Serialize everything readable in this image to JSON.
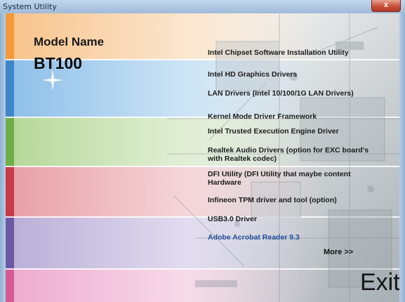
{
  "window": {
    "title": "System Utility",
    "close_label": "x"
  },
  "model": {
    "label": "Model Name",
    "value": "BT100"
  },
  "menu": {
    "items": [
      {
        "label": "Intel Chipset Software Installation Utility"
      },
      {
        "label": "Intel HD Graphics Drivers"
      },
      {
        "label": "LAN Drivers  (Intel 10/100/1G LAN Drivers)"
      },
      {
        "label": "Kernel Mode Driver Framework"
      },
      {
        "label": "Intel Trusted Execution Engine Driver"
      },
      {
        "label": "Realtek Audio Drivers  (option for EXC board's with Realtek codec)"
      },
      {
        "label": "DFI Utility  (DFI Utility that maybe content Hardware"
      },
      {
        "label": "Infineon TPM driver and tool (option)"
      },
      {
        "label": "USB3.0 Driver"
      },
      {
        "label": "Adobe Acrobat Reader 9.3"
      }
    ],
    "more_label": "More >>",
    "exit_label": "Exit"
  },
  "colors": {
    "orange": "#f39a3a",
    "blue": "#3f86c9",
    "green": "#6fae46",
    "red": "#c73a4a",
    "purple": "#6b5aa3",
    "pink": "#d55a97",
    "link": "#1f4f9c"
  }
}
